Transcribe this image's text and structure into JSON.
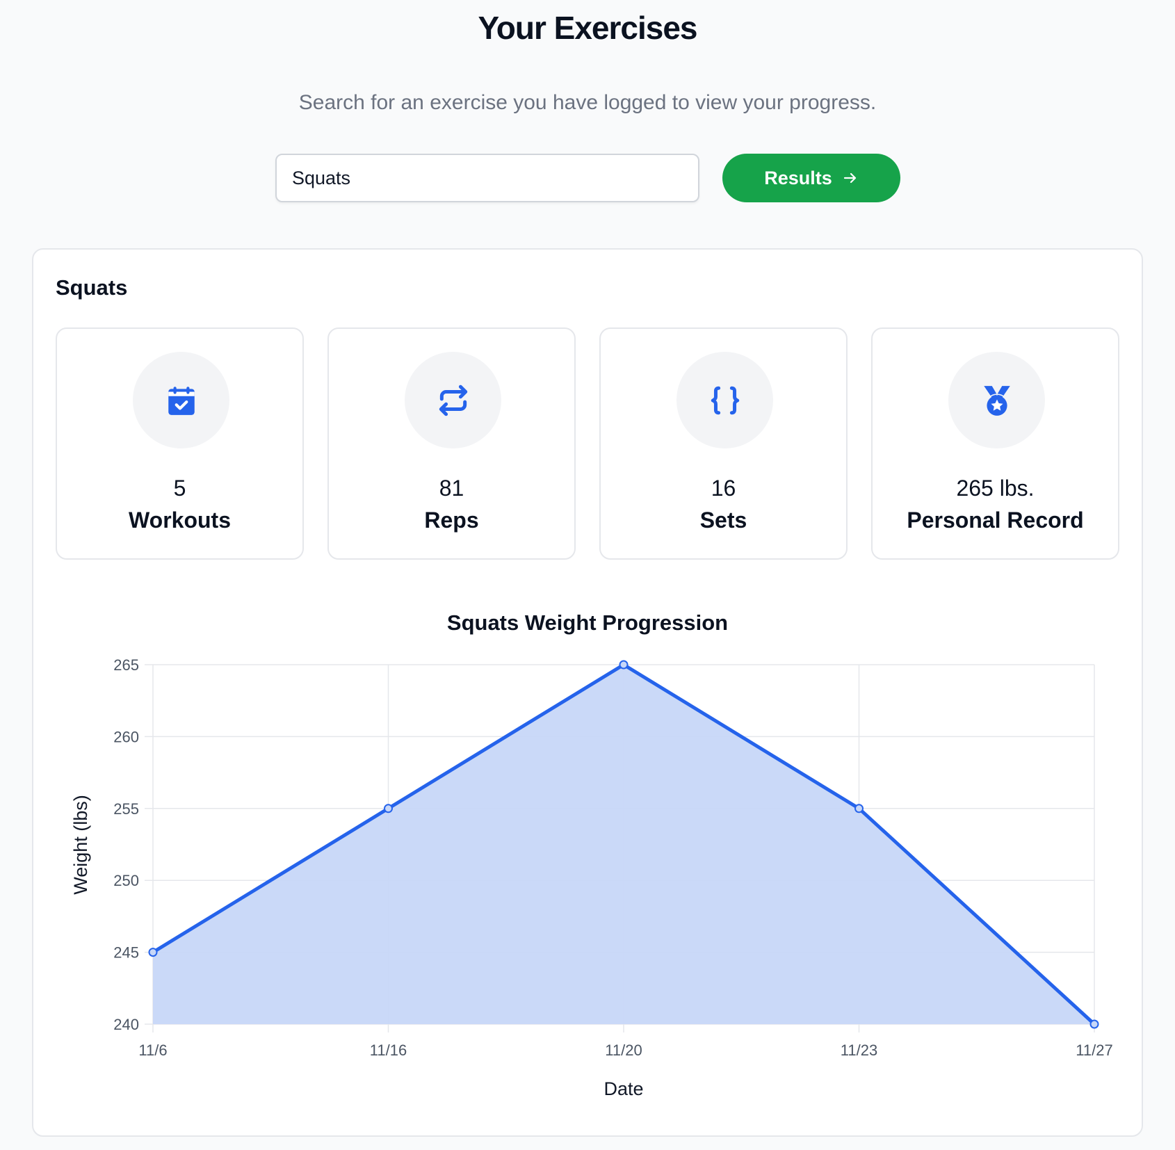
{
  "header": {
    "title": "Your Exercises",
    "subtitle": "Search for an exercise you have logged to view your progress."
  },
  "search": {
    "value": "Squats",
    "placeholder": "",
    "button_label": "Results",
    "button_icon": "arrow-right-icon",
    "button_color": "#16a34a"
  },
  "exercise": {
    "name": "Squats",
    "stats": [
      {
        "icon": "calendar-check-icon",
        "value": "5",
        "label": "Workouts"
      },
      {
        "icon": "repeat-icon",
        "value": "81",
        "label": "Reps"
      },
      {
        "icon": "braces-icon",
        "value": "16",
        "label": "Sets"
      },
      {
        "icon": "medal-icon",
        "value": "265 lbs.",
        "label": "Personal Record"
      }
    ],
    "accent_color": "#2563eb"
  },
  "chart_data": {
    "type": "area",
    "title": "Squats Weight Progression",
    "xlabel": "Date",
    "ylabel": "Weight (lbs)",
    "categories": [
      "11/6",
      "11/16",
      "11/20",
      "11/23",
      "11/27"
    ],
    "series": [
      {
        "name": "Weight",
        "values": [
          245,
          255,
          265,
          255,
          240
        ],
        "color": "#2563eb",
        "fill": "#c7d7f8"
      }
    ],
    "ylim": [
      240,
      265
    ],
    "yticks": [
      240,
      245,
      250,
      255,
      260,
      265
    ],
    "grid": true,
    "legend": "none"
  }
}
